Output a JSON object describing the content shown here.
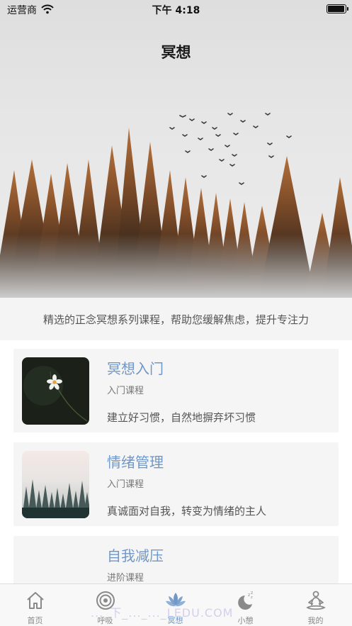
{
  "status_bar": {
    "carrier": "运营商",
    "time": "下午 4:18",
    "battery_level": 1.0
  },
  "page": {
    "title": "冥想",
    "subtitle": "精选的正念冥想系列课程，帮助您缓解焦虑，提升专注力"
  },
  "courses": [
    {
      "title": "冥想入门",
      "level": "入门课程",
      "description": "建立好习惯，自然地摒弃坏习惯",
      "thumbnail": "white-flower-dark-background"
    },
    {
      "title": "情绪管理",
      "level": "入门课程",
      "description": "真诚面对自我，转变为情绪的主人",
      "thumbnail": "misty-pine-forest"
    },
    {
      "title": "自我减压",
      "level": "进阶课程",
      "description": "",
      "thumbnail": ""
    }
  ],
  "tab_bar": {
    "active_index": 2,
    "accent_color": "#6f98c9",
    "items": [
      {
        "label": "首页",
        "icon": "home-icon"
      },
      {
        "label": "呼吸",
        "icon": "breath-target-icon"
      },
      {
        "label": "冥想",
        "icon": "lotus-icon"
      },
      {
        "label": "小憩",
        "icon": "moon-zzz-icon"
      },
      {
        "label": "我的",
        "icon": "meditation-person-icon"
      }
    ]
  },
  "watermark": "..._下_..._..._LEDU.COM"
}
